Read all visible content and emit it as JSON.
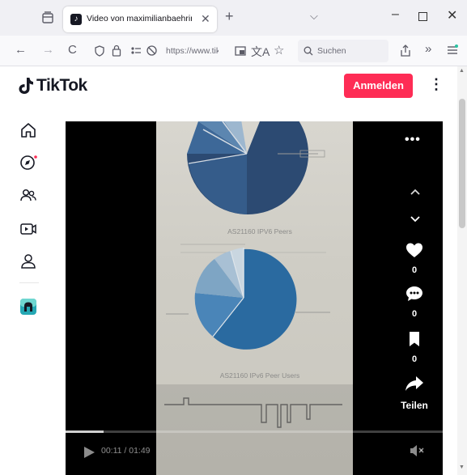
{
  "browser": {
    "tab": {
      "title": "Video von maximilianbaehring",
      "close": "✕"
    },
    "newtab": "+",
    "tabs_menu": "⌵",
    "window": {
      "minimize": "–",
      "close": "✕"
    },
    "nav": {
      "back": "←",
      "forward": "→",
      "reload": "C",
      "url": "https://www.tik",
      "search_placeholder": "Suchen",
      "overflow": "»"
    }
  },
  "tiktok": {
    "logo_text": "TikTok",
    "login_label": "Anmelden",
    "more_label": "⋮",
    "sidebar": [
      {
        "name": "home-icon"
      },
      {
        "name": "explore-icon",
        "badge": true
      },
      {
        "name": "following-icon"
      },
      {
        "name": "live-icon"
      },
      {
        "name": "profile-icon"
      },
      {
        "name": "app-icon"
      }
    ],
    "video": {
      "more": "•••",
      "likes": "0",
      "comments": "0",
      "bookmarks": "0",
      "share_label": "Teilen",
      "time": "00:11 / 01:49",
      "progress": 0.1,
      "frame_text": {
        "caption_top": "AS21160 IPV6 Peers",
        "caption_bottom": "AS21160 IPv6 Peer Users"
      }
    }
  },
  "colors": {
    "accent": "#fe2c55",
    "pie_dark": "#2c4a72",
    "pie_blue": "#2a6aa0",
    "pie_light": "#7ea5c4"
  }
}
